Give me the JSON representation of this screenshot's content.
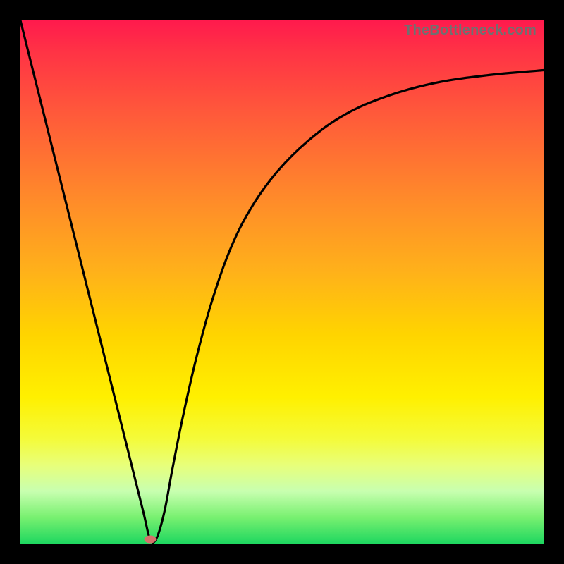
{
  "watermark": "TheBottleneck.com",
  "chart_data": {
    "type": "line",
    "title": "",
    "xlabel": "",
    "ylabel": "",
    "xlim": [
      0,
      1
    ],
    "ylim": [
      0,
      1
    ],
    "grid": false,
    "legend": false,
    "series": [
      {
        "name": "curve",
        "x": [
          0.0,
          0.03,
          0.06,
          0.09,
          0.12,
          0.15,
          0.18,
          0.21,
          0.235,
          0.248,
          0.26,
          0.275,
          0.29,
          0.31,
          0.335,
          0.365,
          0.4,
          0.44,
          0.49,
          0.55,
          0.62,
          0.7,
          0.79,
          0.89,
          1.0
        ],
        "y": [
          1.0,
          0.88,
          0.76,
          0.64,
          0.52,
          0.4,
          0.28,
          0.16,
          0.06,
          0.008,
          0.01,
          0.06,
          0.14,
          0.24,
          0.35,
          0.46,
          0.56,
          0.64,
          0.71,
          0.77,
          0.82,
          0.855,
          0.88,
          0.895,
          0.905
        ]
      }
    ],
    "marker": {
      "x": 0.248,
      "y": 0.008
    },
    "background_gradient": {
      "direction": "top-to-bottom",
      "stops": [
        {
          "pos": 0.0,
          "color": "#ff1a4d"
        },
        {
          "pos": 0.18,
          "color": "#ff5a3a"
        },
        {
          "pos": 0.48,
          "color": "#ffb11a"
        },
        {
          "pos": 0.72,
          "color": "#fff000"
        },
        {
          "pos": 0.9,
          "color": "#c8ffb0"
        },
        {
          "pos": 1.0,
          "color": "#1ed760"
        }
      ]
    }
  }
}
